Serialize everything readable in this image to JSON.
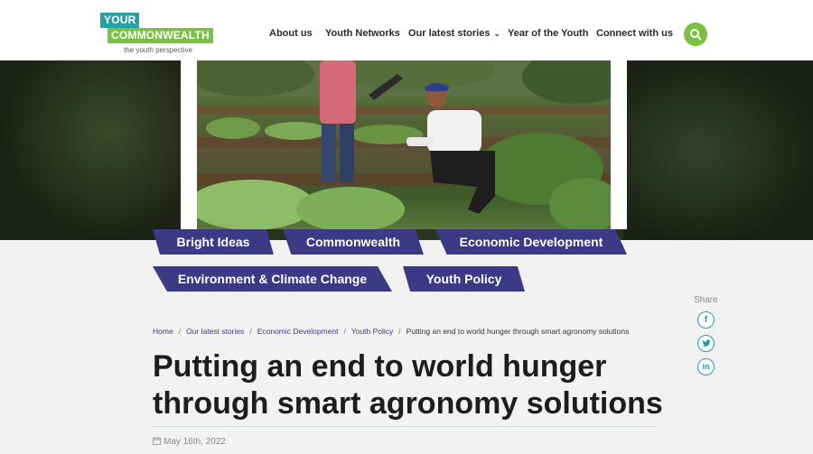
{
  "logo": {
    "line1": "YOUR",
    "line2": "COMMONWEALTH",
    "tagline": "the youth perspective"
  },
  "nav": {
    "items": [
      {
        "label": "About us"
      },
      {
        "label": "Youth Networks"
      },
      {
        "label": "Our latest stories",
        "has_dropdown": true
      },
      {
        "label": "Year of the Youth"
      },
      {
        "label": "Connect with us"
      }
    ],
    "search_icon": "search-icon"
  },
  "tags": [
    {
      "label": "Bright Ideas"
    },
    {
      "label": "Commonwealth"
    },
    {
      "label": "Economic Development"
    },
    {
      "label": "Environment & Climate Change"
    },
    {
      "label": "Youth Policy"
    }
  ],
  "share": {
    "label": "Share",
    "icons": [
      "facebook-icon",
      "twitter-icon",
      "linkedin-icon"
    ]
  },
  "breadcrumb": {
    "items": [
      "Home",
      "Our latest stories",
      "Economic Development",
      "Youth Policy"
    ],
    "current": "Putting an end to world hunger through smart agronomy solutions"
  },
  "article": {
    "title_line1": "Putting an end to world hunger",
    "title_line2": "through smart agronomy solutions",
    "date": "May 16th, 2022"
  },
  "colors": {
    "tag_bg": "#3b3a86",
    "accent_green": "#7ac143",
    "accent_teal": "#27a0a6"
  }
}
